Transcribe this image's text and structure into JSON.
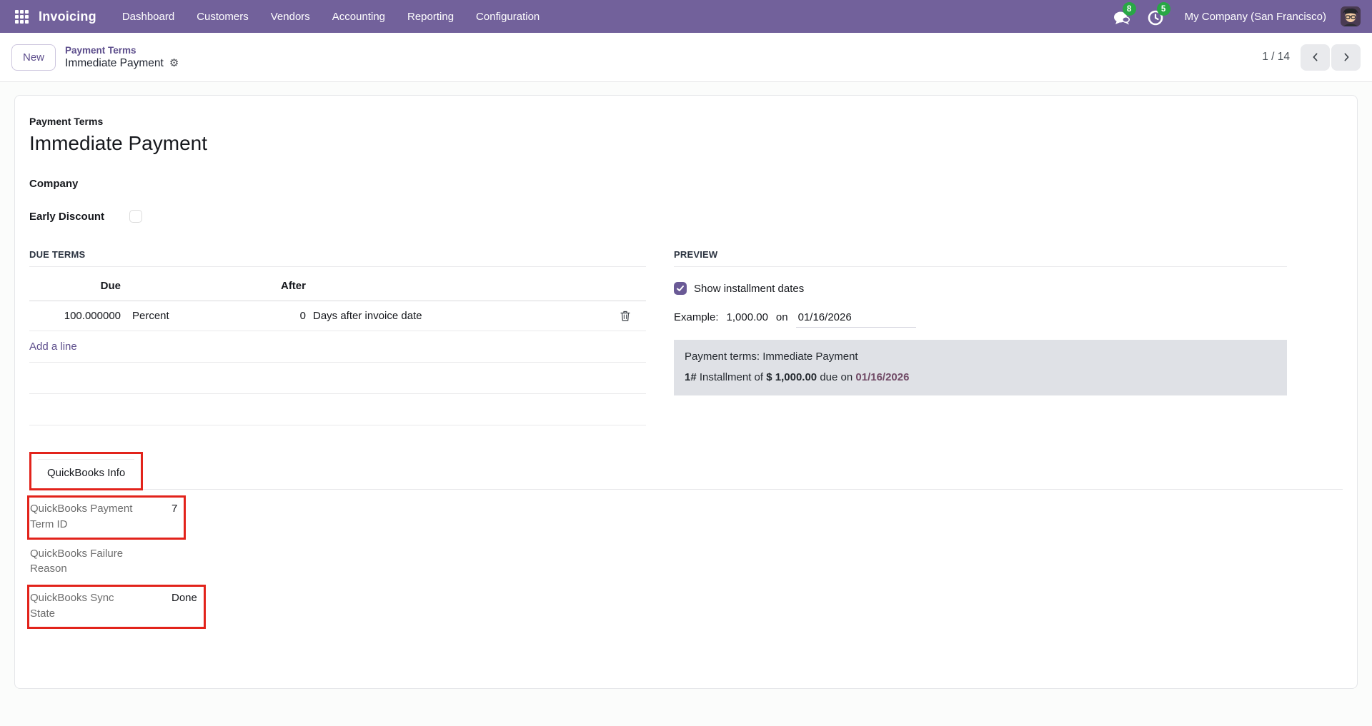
{
  "topbar": {
    "app_name": "Invoicing",
    "menus": [
      "Dashboard",
      "Customers",
      "Vendors",
      "Accounting",
      "Reporting",
      "Configuration"
    ],
    "messages_count": "8",
    "activities_count": "5",
    "company": "My Company (San Francisco)"
  },
  "breadcrumb": {
    "new_button": "New",
    "parent": "Payment Terms",
    "current": "Immediate Payment",
    "pager_count": "1 / 14"
  },
  "form": {
    "record_label": "Payment Terms",
    "record_name": "Immediate Payment",
    "company_label": "Company",
    "early_discount_label": "Early Discount",
    "due_terms": {
      "heading": "DUE TERMS",
      "col_due": "Due",
      "col_after": "After",
      "rows": [
        {
          "value": "100.000000",
          "value_type": "Percent",
          "days": "0",
          "after": "Days after invoice date"
        }
      ],
      "add_line_label": "Add a line"
    },
    "preview": {
      "heading": "PREVIEW",
      "show_installment_label": "Show installment dates",
      "example_label": "Example:",
      "example_amount": "1,000.00",
      "example_on": "on",
      "example_date": "01/16/2026",
      "terms_line": "Payment terms: Immediate Payment",
      "installment_prefix": "1#",
      "installment_text": "Installment of",
      "installment_amount": "$ 1,000.00",
      "installment_due": "due on",
      "installment_date": "01/16/2026"
    },
    "tab_label": "QuickBooks Info",
    "quickbooks_fields": [
      {
        "label": "QuickBooks Payment Term ID",
        "value": "7"
      },
      {
        "label": "QuickBooks Failure Reason",
        "value": ""
      },
      {
        "label": "QuickBooks Sync State",
        "value": "Done"
      }
    ]
  },
  "colors": {
    "navbar_purple": "#72619b",
    "accent_purple": "#5d4e8c",
    "badge_green": "#28a745",
    "annotation_red": "#e2231b",
    "preview_box_gray": "#dfe1e6",
    "plum_date": "#714b67"
  }
}
